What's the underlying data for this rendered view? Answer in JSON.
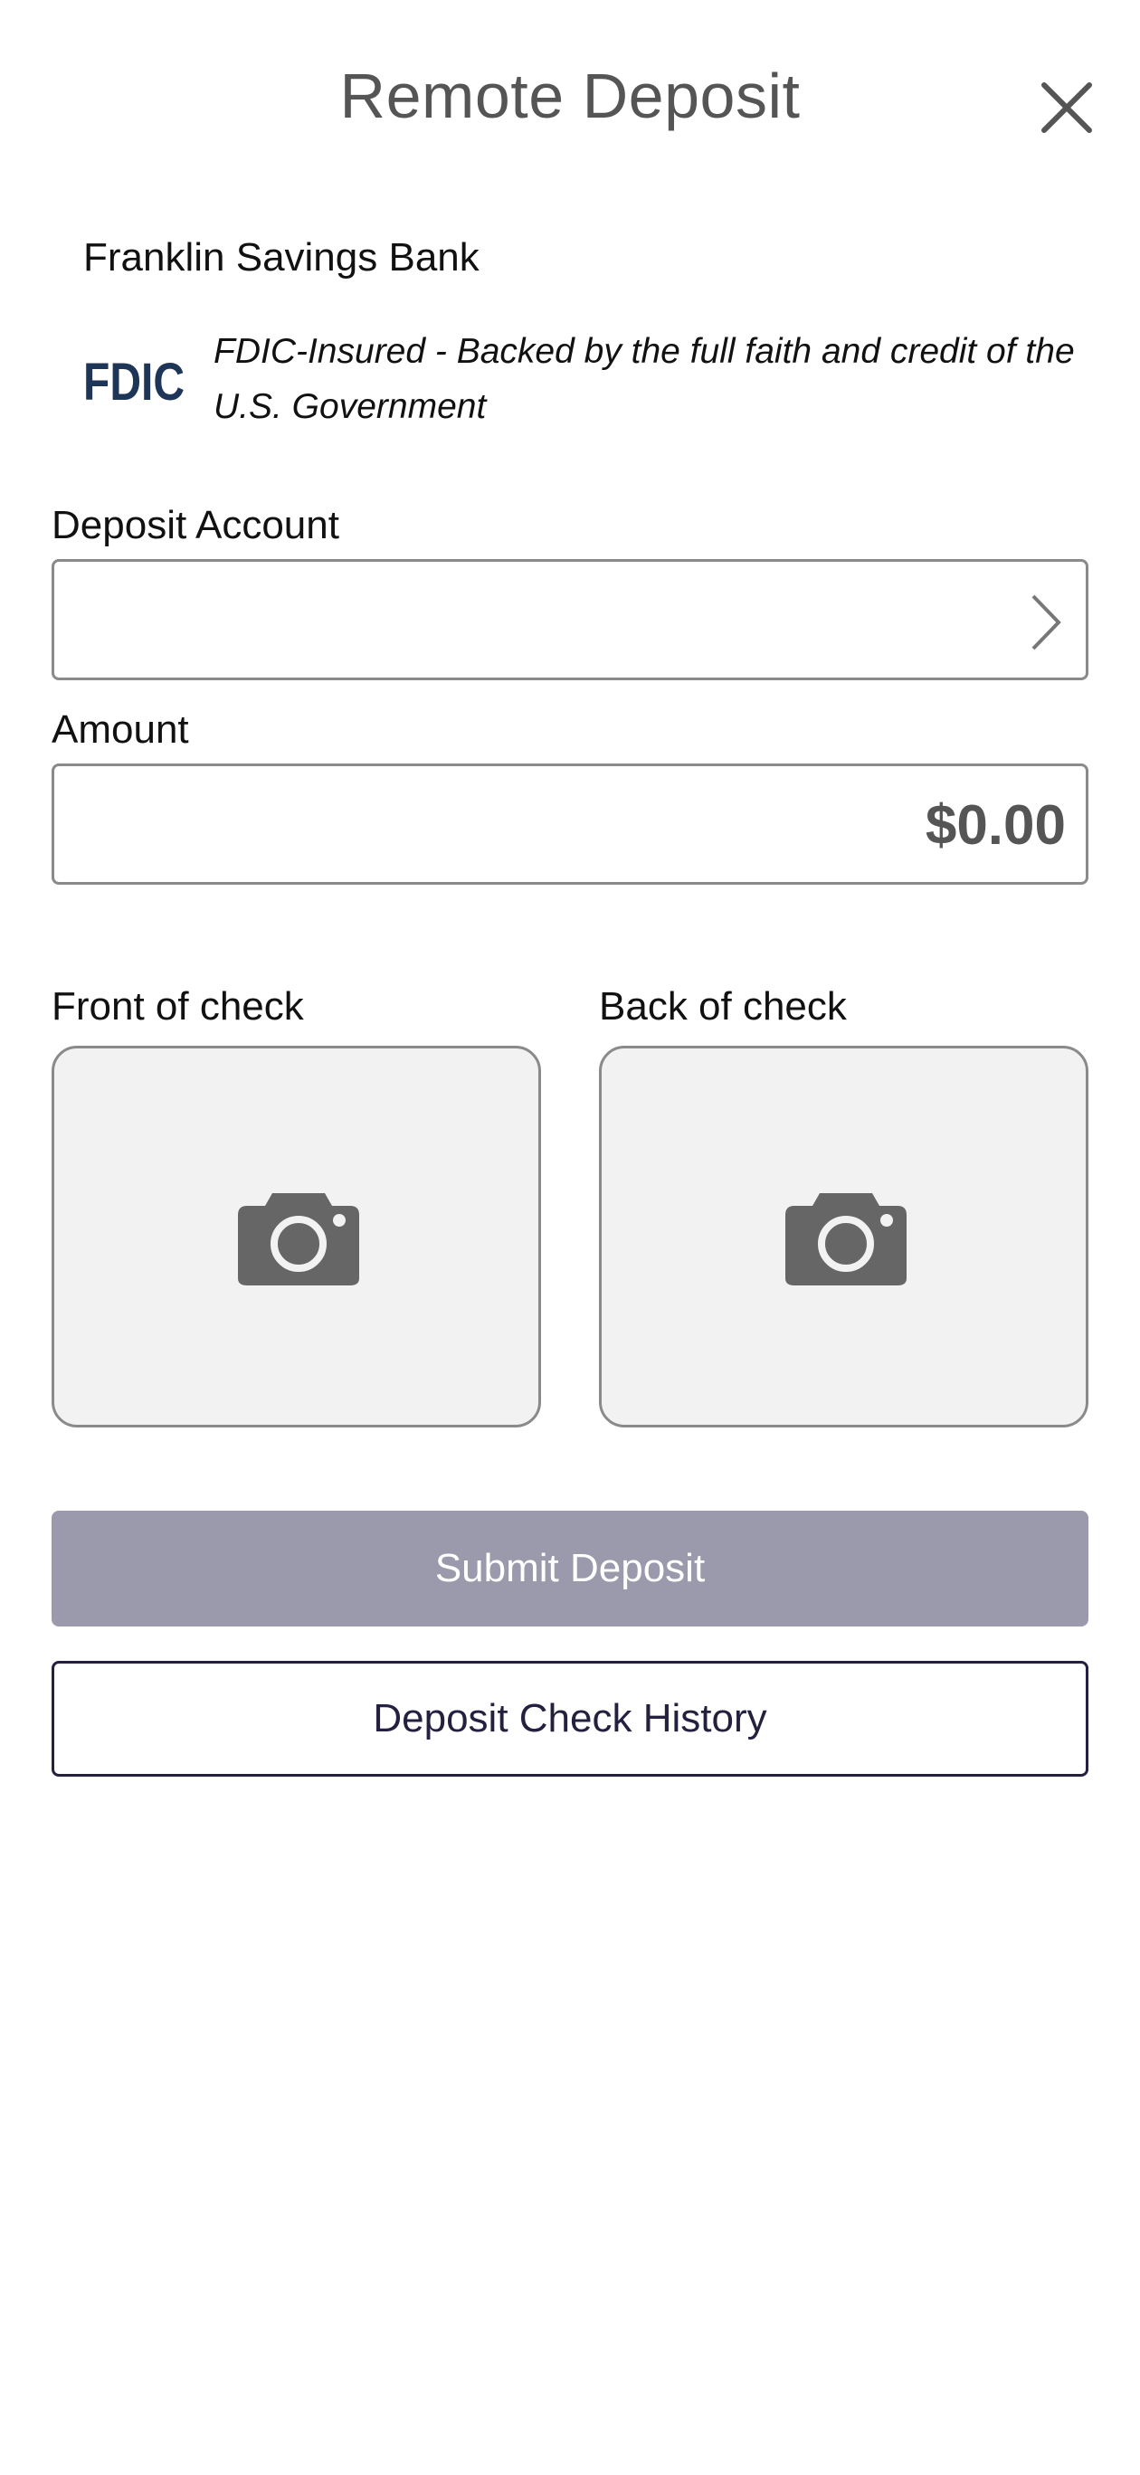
{
  "header": {
    "title": "Remote Deposit",
    "close_icon": "close-icon"
  },
  "bank": {
    "name": "Franklin Savings Bank",
    "logo_text": "FDIC",
    "insured_text": "FDIC-Insured - Backed by the full faith and credit of the U.S. Government"
  },
  "form": {
    "deposit_account_label": "Deposit Account",
    "deposit_account_value": "",
    "amount_label": "Amount",
    "amount_value": "$0.00"
  },
  "checks": {
    "front_label": "Front of check",
    "back_label": "Back of check",
    "icon": "camera-icon"
  },
  "actions": {
    "submit_label": "Submit Deposit",
    "history_label": "Deposit Check History"
  },
  "colors": {
    "submit_disabled": "#9b9aac",
    "history_border": "#23213f",
    "fdic_navy": "#1d3557",
    "icon_gray": "#666666"
  }
}
